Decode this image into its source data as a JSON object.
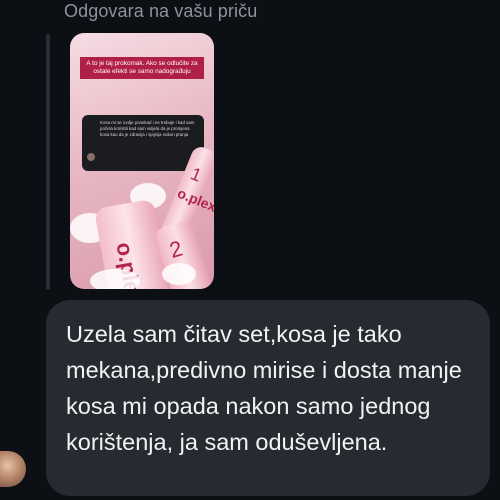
{
  "reply_header": {
    "label": "Odgovara na vašu priču"
  },
  "story": {
    "banner_text": "A to je taj prokomak. Ako se odlučite za ostale efekti se samo nadograđuju",
    "bubble_text": "Kosa mi se ovdje ponekad i ne trebuje i kad sam počela koristiti kad sam vidjela da je promjena kosa kao da je zdravija i sjajnija nakon pranja",
    "product_name": "o.plex",
    "bottle_numbers": [
      "1",
      "2"
    ]
  },
  "message": {
    "text": "Uzela sam čitav set,kosa je tako mekana,predivno mirise i dosta manje kosa mi opada nakon samo jednog korištenja, ja sam oduševljena."
  },
  "colors": {
    "background": "#0c0f14",
    "bubble": "#262a31",
    "reply_text": "#8e939b",
    "banner": "#b01f45"
  }
}
